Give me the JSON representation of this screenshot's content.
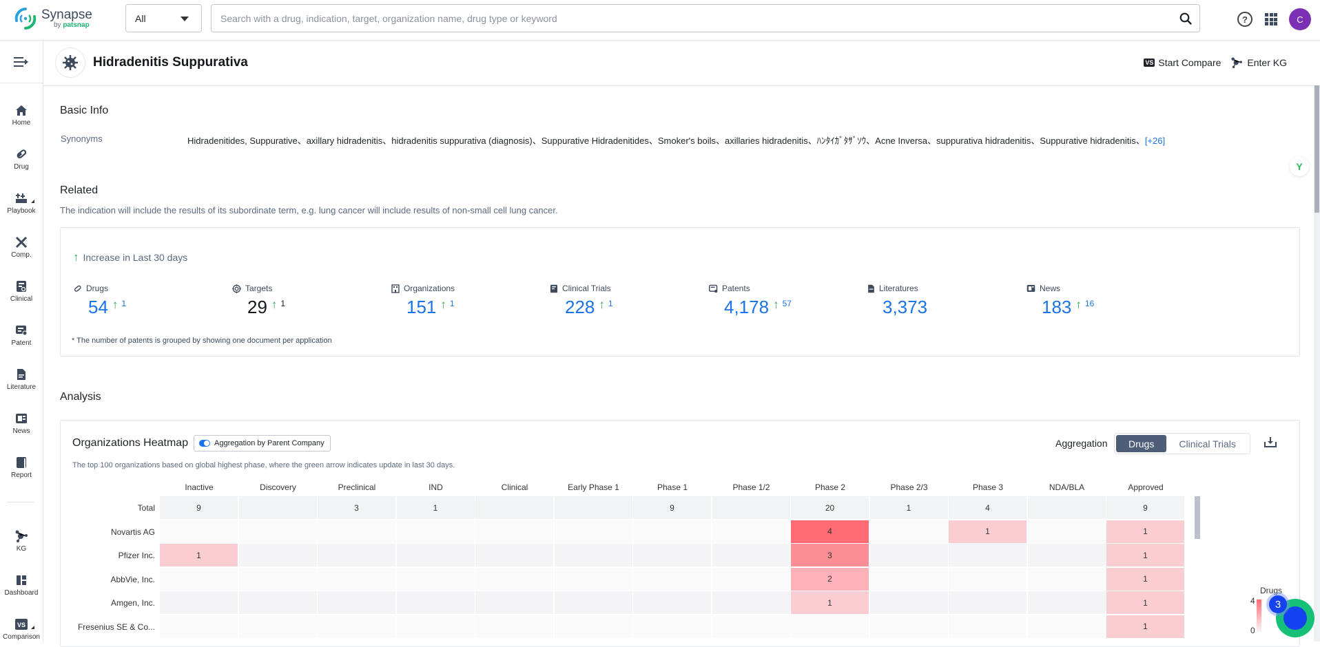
{
  "app": {
    "name": "Synapse",
    "by": "by",
    "brand": "patsnap"
  },
  "search": {
    "type_value": "All",
    "placeholder": "Search with a drug, indication, target, organization name, drug type or keyword"
  },
  "user": {
    "avatar_letter": "C"
  },
  "sidebar": {
    "items": [
      {
        "label": "Home"
      },
      {
        "label": "Drug"
      },
      {
        "label": "Playbook"
      },
      {
        "label": "Comp."
      },
      {
        "label": "Clinical"
      },
      {
        "label": "Patent"
      },
      {
        "label": "Literature"
      },
      {
        "label": "News"
      },
      {
        "label": "Report"
      },
      {
        "label": "KG"
      },
      {
        "label": "Dashboard"
      },
      {
        "label": "Comparison"
      }
    ]
  },
  "header": {
    "title": "Hidradenitis Suppurativa",
    "compare_badge": "VS",
    "compare_label": "Start Compare",
    "kg_label": "Enter KG"
  },
  "basic_info": {
    "title": "Basic Info",
    "synonyms_label": "Synonyms",
    "synonyms": "Hidradenitides, Suppurative、axillary hidradenitis、hidradenitis suppurativa (diagnosis)、Suppurative Hidradenitides、Smoker's boils、axillaries hidradenitis、ﾊﾝﾀｲｶﾞﾀｻﾞｿｳ、Acne Inversa、suppurativa hidradenitis、Suppurative hidradenitis、",
    "synonyms_more": "[+26]"
  },
  "related": {
    "title": "Related",
    "description": "The indication will include the results of its subordinate term, e.g. lung cancer will include results of non-small cell lung cancer.",
    "increase_label": "Increase in Last 30 days",
    "stats": [
      {
        "label": "Drugs",
        "value": "54",
        "delta": "1"
      },
      {
        "label": "Targets",
        "value": "29",
        "delta": "1"
      },
      {
        "label": "Organizations",
        "value": "151",
        "delta": "1"
      },
      {
        "label": "Clinical Trials",
        "value": "228",
        "delta": "1"
      },
      {
        "label": "Patents",
        "value": "4,178",
        "delta": "57"
      },
      {
        "label": "Literatures",
        "value": "3,373",
        "delta": ""
      },
      {
        "label": "News",
        "value": "183",
        "delta": "16"
      }
    ],
    "footnote": "* The number of patents is grouped by showing one document per application"
  },
  "analysis": {
    "title": "Analysis",
    "heatmap_title": "Organizations Heatmap",
    "toggle_label": "Aggregation by Parent Company",
    "description": "The top 100 organizations based on global highest phase, where the green arrow indicates update in last 30 days.",
    "aggregation_label": "Aggregation",
    "aggregation_options": [
      "Drugs",
      "Clinical Trials"
    ],
    "aggregation_selected": "Drugs",
    "accent": "#4e5d78"
  },
  "chart_data": {
    "type": "heatmap",
    "title": "Organizations Heatmap",
    "columns": [
      "Inactive",
      "Discovery",
      "Preclinical",
      "IND",
      "Clinical",
      "Early Phase 1",
      "Phase 1",
      "Phase 1/2",
      "Phase 2",
      "Phase 2/3",
      "Phase 3",
      "NDA/BLA",
      "Approved"
    ],
    "rows": [
      {
        "name": "Total",
        "values": [
          9,
          null,
          3,
          1,
          null,
          null,
          9,
          null,
          20,
          1,
          4,
          null,
          9
        ]
      },
      {
        "name": "Novartis AG",
        "values": [
          null,
          null,
          null,
          null,
          null,
          null,
          null,
          null,
          4,
          null,
          1,
          null,
          1
        ]
      },
      {
        "name": "Pfizer Inc.",
        "values": [
          1,
          null,
          null,
          null,
          null,
          null,
          null,
          null,
          3,
          null,
          null,
          null,
          1
        ]
      },
      {
        "name": "AbbVie, Inc.",
        "values": [
          null,
          null,
          null,
          null,
          null,
          null,
          null,
          null,
          2,
          null,
          null,
          null,
          1
        ]
      },
      {
        "name": "Amgen, Inc.",
        "values": [
          null,
          null,
          null,
          null,
          null,
          null,
          null,
          null,
          1,
          null,
          null,
          null,
          1
        ]
      },
      {
        "name": "Fresenius SE & Co...",
        "values": [
          null,
          null,
          null,
          null,
          null,
          null,
          null,
          null,
          null,
          null,
          null,
          null,
          1
        ]
      }
    ],
    "legend": {
      "title": "Drugs",
      "min": 0,
      "max": 4,
      "min_color": "#f7f7f8",
      "max_color": "#ff6b75"
    }
  },
  "assistant": {
    "badge_count": "3"
  }
}
